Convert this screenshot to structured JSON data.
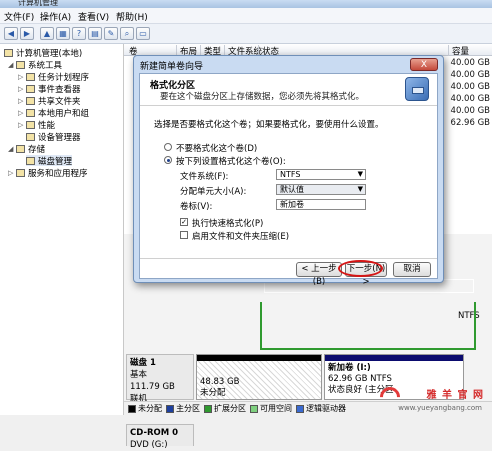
{
  "window": {
    "title": "计算机管理"
  },
  "menu": [
    "文件(F)",
    "操作(A)",
    "查看(V)",
    "帮助(H)"
  ],
  "tree": {
    "root": "计算机管理(本地)",
    "items": [
      {
        "label": "系统工具",
        "level": 1
      },
      {
        "label": "任务计划程序",
        "level": 2
      },
      {
        "label": "事件查看器",
        "level": 2
      },
      {
        "label": "共享文件夹",
        "level": 2
      },
      {
        "label": "本地用户和组",
        "level": 2
      },
      {
        "label": "性能",
        "level": 2
      },
      {
        "label": "设备管理器",
        "level": 2
      },
      {
        "label": "存储",
        "level": 1
      },
      {
        "label": "磁盘管理",
        "level": 2
      },
      {
        "label": "服务和应用程序",
        "level": 1
      }
    ]
  },
  "columns": [
    "卷",
    "布局",
    "类型",
    "文件系统",
    "状态",
    "容量"
  ],
  "capacities": [
    "40.00 GB",
    "40.00 GB",
    "40.00 GB",
    "40.00 GB",
    "40.00 GB",
    "62.96 GB"
  ],
  "graph": {
    "disk1": {
      "name": "磁盘 1",
      "type": "基本",
      "size": "111.79 GB",
      "status": "联机"
    },
    "unallocated": {
      "size": "48.83 GB",
      "label": "未分配"
    },
    "newvol": {
      "name": "新加卷 (I:)",
      "size": "62.96 GB NTFS",
      "status": "状态良好 (主分区"
    },
    "cdrom": {
      "name": "CD-ROM 0",
      "type": "DVD (G:)"
    },
    "upper_fragment": "NTFS"
  },
  "legend": [
    "未分配",
    "主分区",
    "扩展分区",
    "可用空间",
    "逻辑驱动器"
  ],
  "dialog": {
    "title": "新建简单卷向导",
    "close": "X",
    "heading": "格式化分区",
    "subheading": "要在这个磁盘分区上存储数据，您必须先将其格式化。",
    "prompt": "选择是否要格式化这个卷；如果要格式化，要使用什么设置。",
    "option_no": "不要格式化这个卷(D)",
    "option_yes": "按下列设置格式化这个卷(O):",
    "fs_label": "文件系统(F):",
    "fs_value": "NTFS",
    "alloc_label": "分配单元大小(A):",
    "alloc_value": "默认值",
    "vol_label": "卷标(V):",
    "vol_value": "新加卷",
    "quick_format": "执行快速格式化(P)",
    "compress": "启用文件和文件夹压缩(E)",
    "check_mark": "✓",
    "btn_back": "< 上一步(B)",
    "btn_next": "下一步(N) >",
    "btn_cancel": "取消"
  },
  "watermark": {
    "text": "雅 羊 官 网",
    "url": "www.yueyangbang.com"
  }
}
